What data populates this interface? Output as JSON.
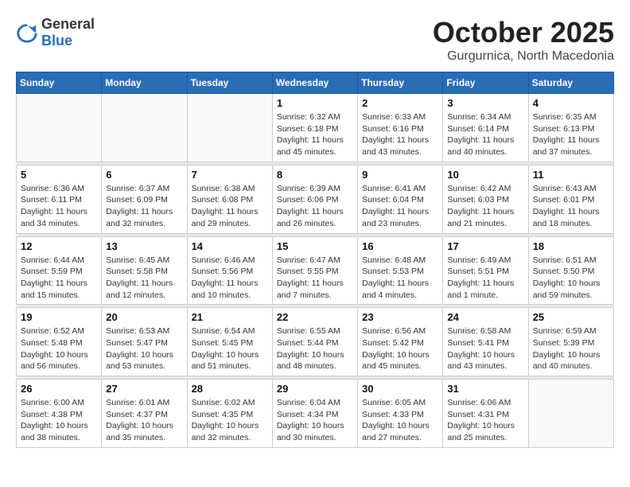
{
  "logo": {
    "general": "General",
    "blue": "Blue"
  },
  "title": "October 2025",
  "subtitle": "Gurgurnica, North Macedonia",
  "weekdays": [
    "Sunday",
    "Monday",
    "Tuesday",
    "Wednesday",
    "Thursday",
    "Friday",
    "Saturday"
  ],
  "weeks": [
    [
      {
        "day": "",
        "sunrise": "",
        "sunset": "",
        "daylight": ""
      },
      {
        "day": "",
        "sunrise": "",
        "sunset": "",
        "daylight": ""
      },
      {
        "day": "",
        "sunrise": "",
        "sunset": "",
        "daylight": ""
      },
      {
        "day": "1",
        "sunrise": "Sunrise: 6:32 AM",
        "sunset": "Sunset: 6:18 PM",
        "daylight": "Daylight: 11 hours and 45 minutes."
      },
      {
        "day": "2",
        "sunrise": "Sunrise: 6:33 AM",
        "sunset": "Sunset: 6:16 PM",
        "daylight": "Daylight: 11 hours and 43 minutes."
      },
      {
        "day": "3",
        "sunrise": "Sunrise: 6:34 AM",
        "sunset": "Sunset: 6:14 PM",
        "daylight": "Daylight: 11 hours and 40 minutes."
      },
      {
        "day": "4",
        "sunrise": "Sunrise: 6:35 AM",
        "sunset": "Sunset: 6:13 PM",
        "daylight": "Daylight: 11 hours and 37 minutes."
      }
    ],
    [
      {
        "day": "5",
        "sunrise": "Sunrise: 6:36 AM",
        "sunset": "Sunset: 6:11 PM",
        "daylight": "Daylight: 11 hours and 34 minutes."
      },
      {
        "day": "6",
        "sunrise": "Sunrise: 6:37 AM",
        "sunset": "Sunset: 6:09 PM",
        "daylight": "Daylight: 11 hours and 32 minutes."
      },
      {
        "day": "7",
        "sunrise": "Sunrise: 6:38 AM",
        "sunset": "Sunset: 6:08 PM",
        "daylight": "Daylight: 11 hours and 29 minutes."
      },
      {
        "day": "8",
        "sunrise": "Sunrise: 6:39 AM",
        "sunset": "Sunset: 6:06 PM",
        "daylight": "Daylight: 11 hours and 26 minutes."
      },
      {
        "day": "9",
        "sunrise": "Sunrise: 6:41 AM",
        "sunset": "Sunset: 6:04 PM",
        "daylight": "Daylight: 11 hours and 23 minutes."
      },
      {
        "day": "10",
        "sunrise": "Sunrise: 6:42 AM",
        "sunset": "Sunset: 6:03 PM",
        "daylight": "Daylight: 11 hours and 21 minutes."
      },
      {
        "day": "11",
        "sunrise": "Sunrise: 6:43 AM",
        "sunset": "Sunset: 6:01 PM",
        "daylight": "Daylight: 11 hours and 18 minutes."
      }
    ],
    [
      {
        "day": "12",
        "sunrise": "Sunrise: 6:44 AM",
        "sunset": "Sunset: 5:59 PM",
        "daylight": "Daylight: 11 hours and 15 minutes."
      },
      {
        "day": "13",
        "sunrise": "Sunrise: 6:45 AM",
        "sunset": "Sunset: 5:58 PM",
        "daylight": "Daylight: 11 hours and 12 minutes."
      },
      {
        "day": "14",
        "sunrise": "Sunrise: 6:46 AM",
        "sunset": "Sunset: 5:56 PM",
        "daylight": "Daylight: 11 hours and 10 minutes."
      },
      {
        "day": "15",
        "sunrise": "Sunrise: 6:47 AM",
        "sunset": "Sunset: 5:55 PM",
        "daylight": "Daylight: 11 hours and 7 minutes."
      },
      {
        "day": "16",
        "sunrise": "Sunrise: 6:48 AM",
        "sunset": "Sunset: 5:53 PM",
        "daylight": "Daylight: 11 hours and 4 minutes."
      },
      {
        "day": "17",
        "sunrise": "Sunrise: 6:49 AM",
        "sunset": "Sunset: 5:51 PM",
        "daylight": "Daylight: 11 hours and 1 minute."
      },
      {
        "day": "18",
        "sunrise": "Sunrise: 6:51 AM",
        "sunset": "Sunset: 5:50 PM",
        "daylight": "Daylight: 10 hours and 59 minutes."
      }
    ],
    [
      {
        "day": "19",
        "sunrise": "Sunrise: 6:52 AM",
        "sunset": "Sunset: 5:48 PM",
        "daylight": "Daylight: 10 hours and 56 minutes."
      },
      {
        "day": "20",
        "sunrise": "Sunrise: 6:53 AM",
        "sunset": "Sunset: 5:47 PM",
        "daylight": "Daylight: 10 hours and 53 minutes."
      },
      {
        "day": "21",
        "sunrise": "Sunrise: 6:54 AM",
        "sunset": "Sunset: 5:45 PM",
        "daylight": "Daylight: 10 hours and 51 minutes."
      },
      {
        "day": "22",
        "sunrise": "Sunrise: 6:55 AM",
        "sunset": "Sunset: 5:44 PM",
        "daylight": "Daylight: 10 hours and 48 minutes."
      },
      {
        "day": "23",
        "sunrise": "Sunrise: 6:56 AM",
        "sunset": "Sunset: 5:42 PM",
        "daylight": "Daylight: 10 hours and 45 minutes."
      },
      {
        "day": "24",
        "sunrise": "Sunrise: 6:58 AM",
        "sunset": "Sunset: 5:41 PM",
        "daylight": "Daylight: 10 hours and 43 minutes."
      },
      {
        "day": "25",
        "sunrise": "Sunrise: 6:59 AM",
        "sunset": "Sunset: 5:39 PM",
        "daylight": "Daylight: 10 hours and 40 minutes."
      }
    ],
    [
      {
        "day": "26",
        "sunrise": "Sunrise: 6:00 AM",
        "sunset": "Sunset: 4:38 PM",
        "daylight": "Daylight: 10 hours and 38 minutes."
      },
      {
        "day": "27",
        "sunrise": "Sunrise: 6:01 AM",
        "sunset": "Sunset: 4:37 PM",
        "daylight": "Daylight: 10 hours and 35 minutes."
      },
      {
        "day": "28",
        "sunrise": "Sunrise: 6:02 AM",
        "sunset": "Sunset: 4:35 PM",
        "daylight": "Daylight: 10 hours and 32 minutes."
      },
      {
        "day": "29",
        "sunrise": "Sunrise: 6:04 AM",
        "sunset": "Sunset: 4:34 PM",
        "daylight": "Daylight: 10 hours and 30 minutes."
      },
      {
        "day": "30",
        "sunrise": "Sunrise: 6:05 AM",
        "sunset": "Sunset: 4:33 PM",
        "daylight": "Daylight: 10 hours and 27 minutes."
      },
      {
        "day": "31",
        "sunrise": "Sunrise: 6:06 AM",
        "sunset": "Sunset: 4:31 PM",
        "daylight": "Daylight: 10 hours and 25 minutes."
      },
      {
        "day": "",
        "sunrise": "",
        "sunset": "",
        "daylight": ""
      }
    ]
  ]
}
